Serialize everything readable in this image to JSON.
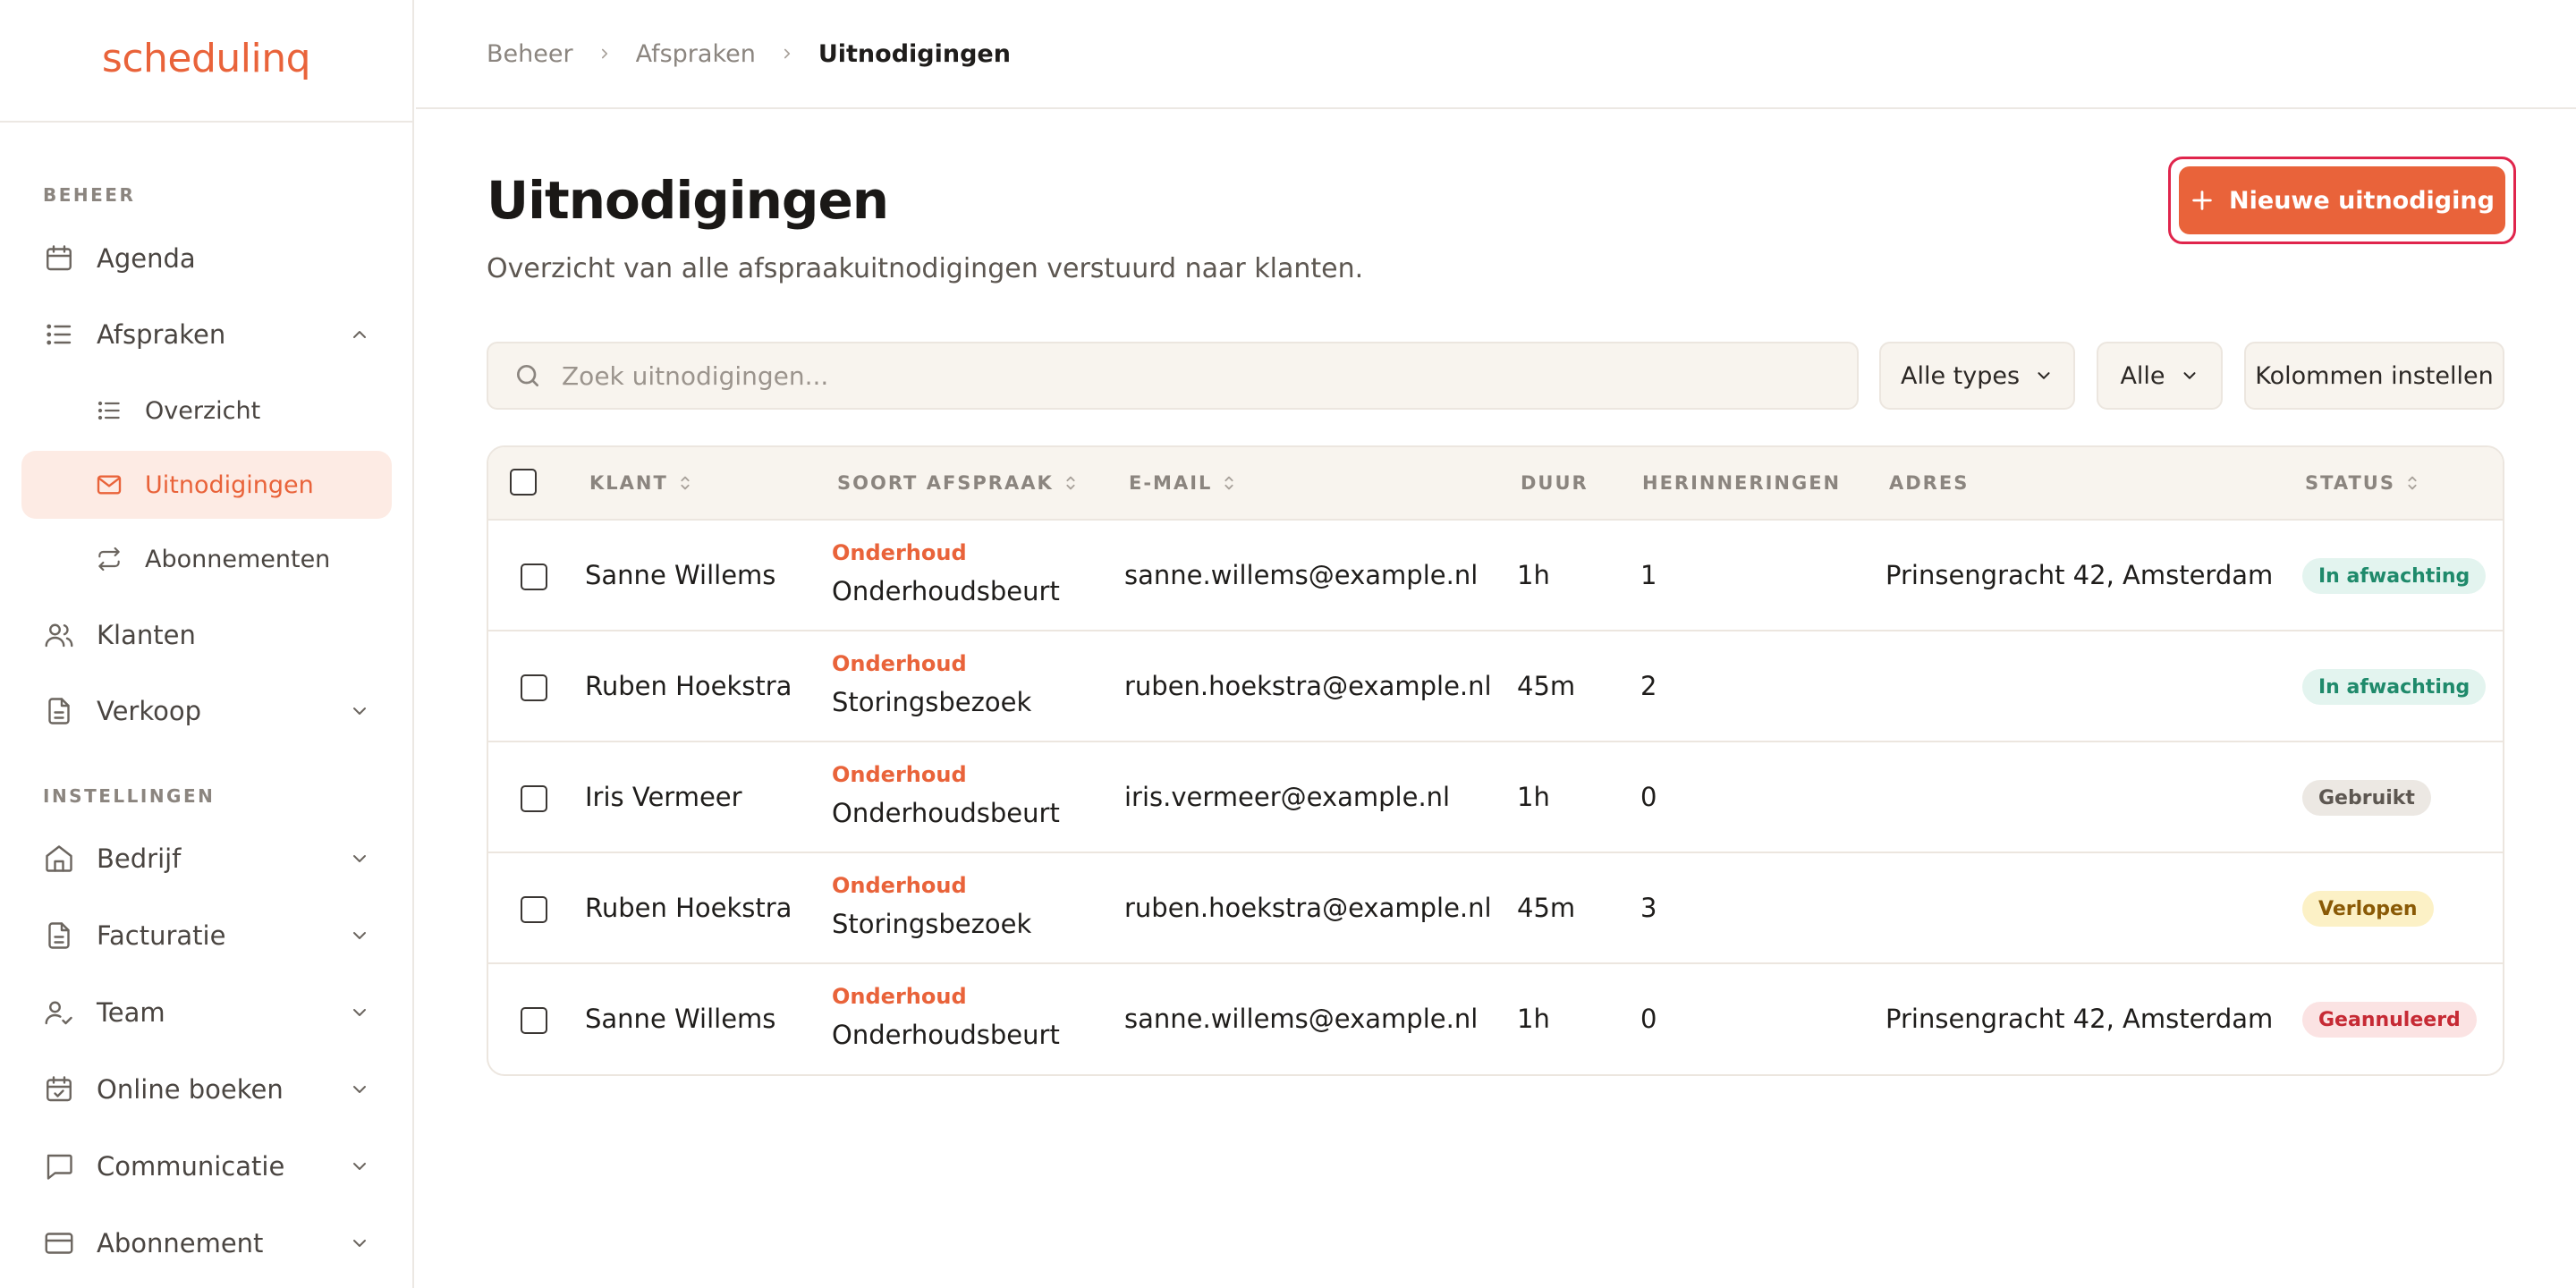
{
  "app": {
    "logo": "schedulinq"
  },
  "sidebar": {
    "sections": [
      {
        "label": "BEHEER"
      },
      {
        "label": "INSTELLINGEN"
      }
    ],
    "items": [
      {
        "label": "Agenda",
        "icon": "calendar-icon"
      },
      {
        "label": "Afspraken",
        "icon": "list-icon"
      },
      {
        "label": "Overzicht",
        "icon": "list-icon"
      },
      {
        "label": "Uitnodigingen",
        "icon": "mail-icon"
      },
      {
        "label": "Abonnementen",
        "icon": "repeat-icon"
      },
      {
        "label": "Klanten",
        "icon": "users-icon"
      },
      {
        "label": "Verkoop",
        "icon": "document-icon"
      },
      {
        "label": "Bedrijf",
        "icon": "building-icon"
      },
      {
        "label": "Facturatie",
        "icon": "document-icon"
      },
      {
        "label": "Team",
        "icon": "user-check-icon"
      },
      {
        "label": "Online boeken",
        "icon": "calendar-check-icon"
      },
      {
        "label": "Communicatie",
        "icon": "chat-icon"
      },
      {
        "label": "Abonnement",
        "icon": "credit-card-icon"
      }
    ]
  },
  "breadcrumb": [
    "Beheer",
    "Afspraken",
    "Uitnodigingen"
  ],
  "header": {
    "title": "Uitnodigingen",
    "subtitle": "Overzicht van alle afspraakuitnodigingen verstuurd naar klanten.",
    "new_button": "Nieuwe uitnodiging"
  },
  "filters": {
    "search_placeholder": "Zoek uitnodigingen...",
    "type": "Alle types",
    "status": "Alle",
    "columns": "Kolommen instellen"
  },
  "table": {
    "columns": [
      "KLANT",
      "SOORT AFSPRAAK",
      "E-MAIL",
      "DUUR",
      "HERINNERINGEN",
      "ADRES",
      "STATUS"
    ],
    "rows": [
      {
        "client": "Sanne Willems",
        "category": "Onderhoud",
        "type": "Onderhoudsbeurt",
        "email": "sanne.willems@example.nl",
        "duration": "1h",
        "reminders": "1",
        "address": "Prinsengracht 42, Amsterdam",
        "status": "In afwachting"
      },
      {
        "client": "Ruben Hoekstra",
        "category": "Onderhoud",
        "type": "Storingsbezoek",
        "email": "ruben.hoekstra@example.nl",
        "duration": "45m",
        "reminders": "2",
        "address": "",
        "status": "In afwachting"
      },
      {
        "client": "Iris Vermeer",
        "category": "Onderhoud",
        "type": "Onderhoudsbeurt",
        "email": "iris.vermeer@example.nl",
        "duration": "1h",
        "reminders": "0",
        "address": "",
        "status": "Gebruikt"
      },
      {
        "client": "Ruben Hoekstra",
        "category": "Onderhoud",
        "type": "Storingsbezoek",
        "email": "ruben.hoekstra@example.nl",
        "duration": "45m",
        "reminders": "3",
        "address": "",
        "status": "Verlopen"
      },
      {
        "client": "Sanne Willems",
        "category": "Onderhoud",
        "type": "Onderhoudsbeurt",
        "email": "sanne.willems@example.nl",
        "duration": "1h",
        "reminders": "0",
        "address": "Prinsengracht 42, Amsterdam",
        "status": "Geannuleerd"
      }
    ]
  },
  "colors": {
    "accent": "#e9633a",
    "pending_bg": "#e3f4ef",
    "pending_fg": "#1f8a6b",
    "used_bg": "#ece8e3",
    "used_fg": "#5d5751",
    "expired_bg": "#fcf1c6",
    "expired_fg": "#8a5a06",
    "cancelled_bg": "#fbe3e3",
    "cancelled_fg": "#c62a34"
  }
}
